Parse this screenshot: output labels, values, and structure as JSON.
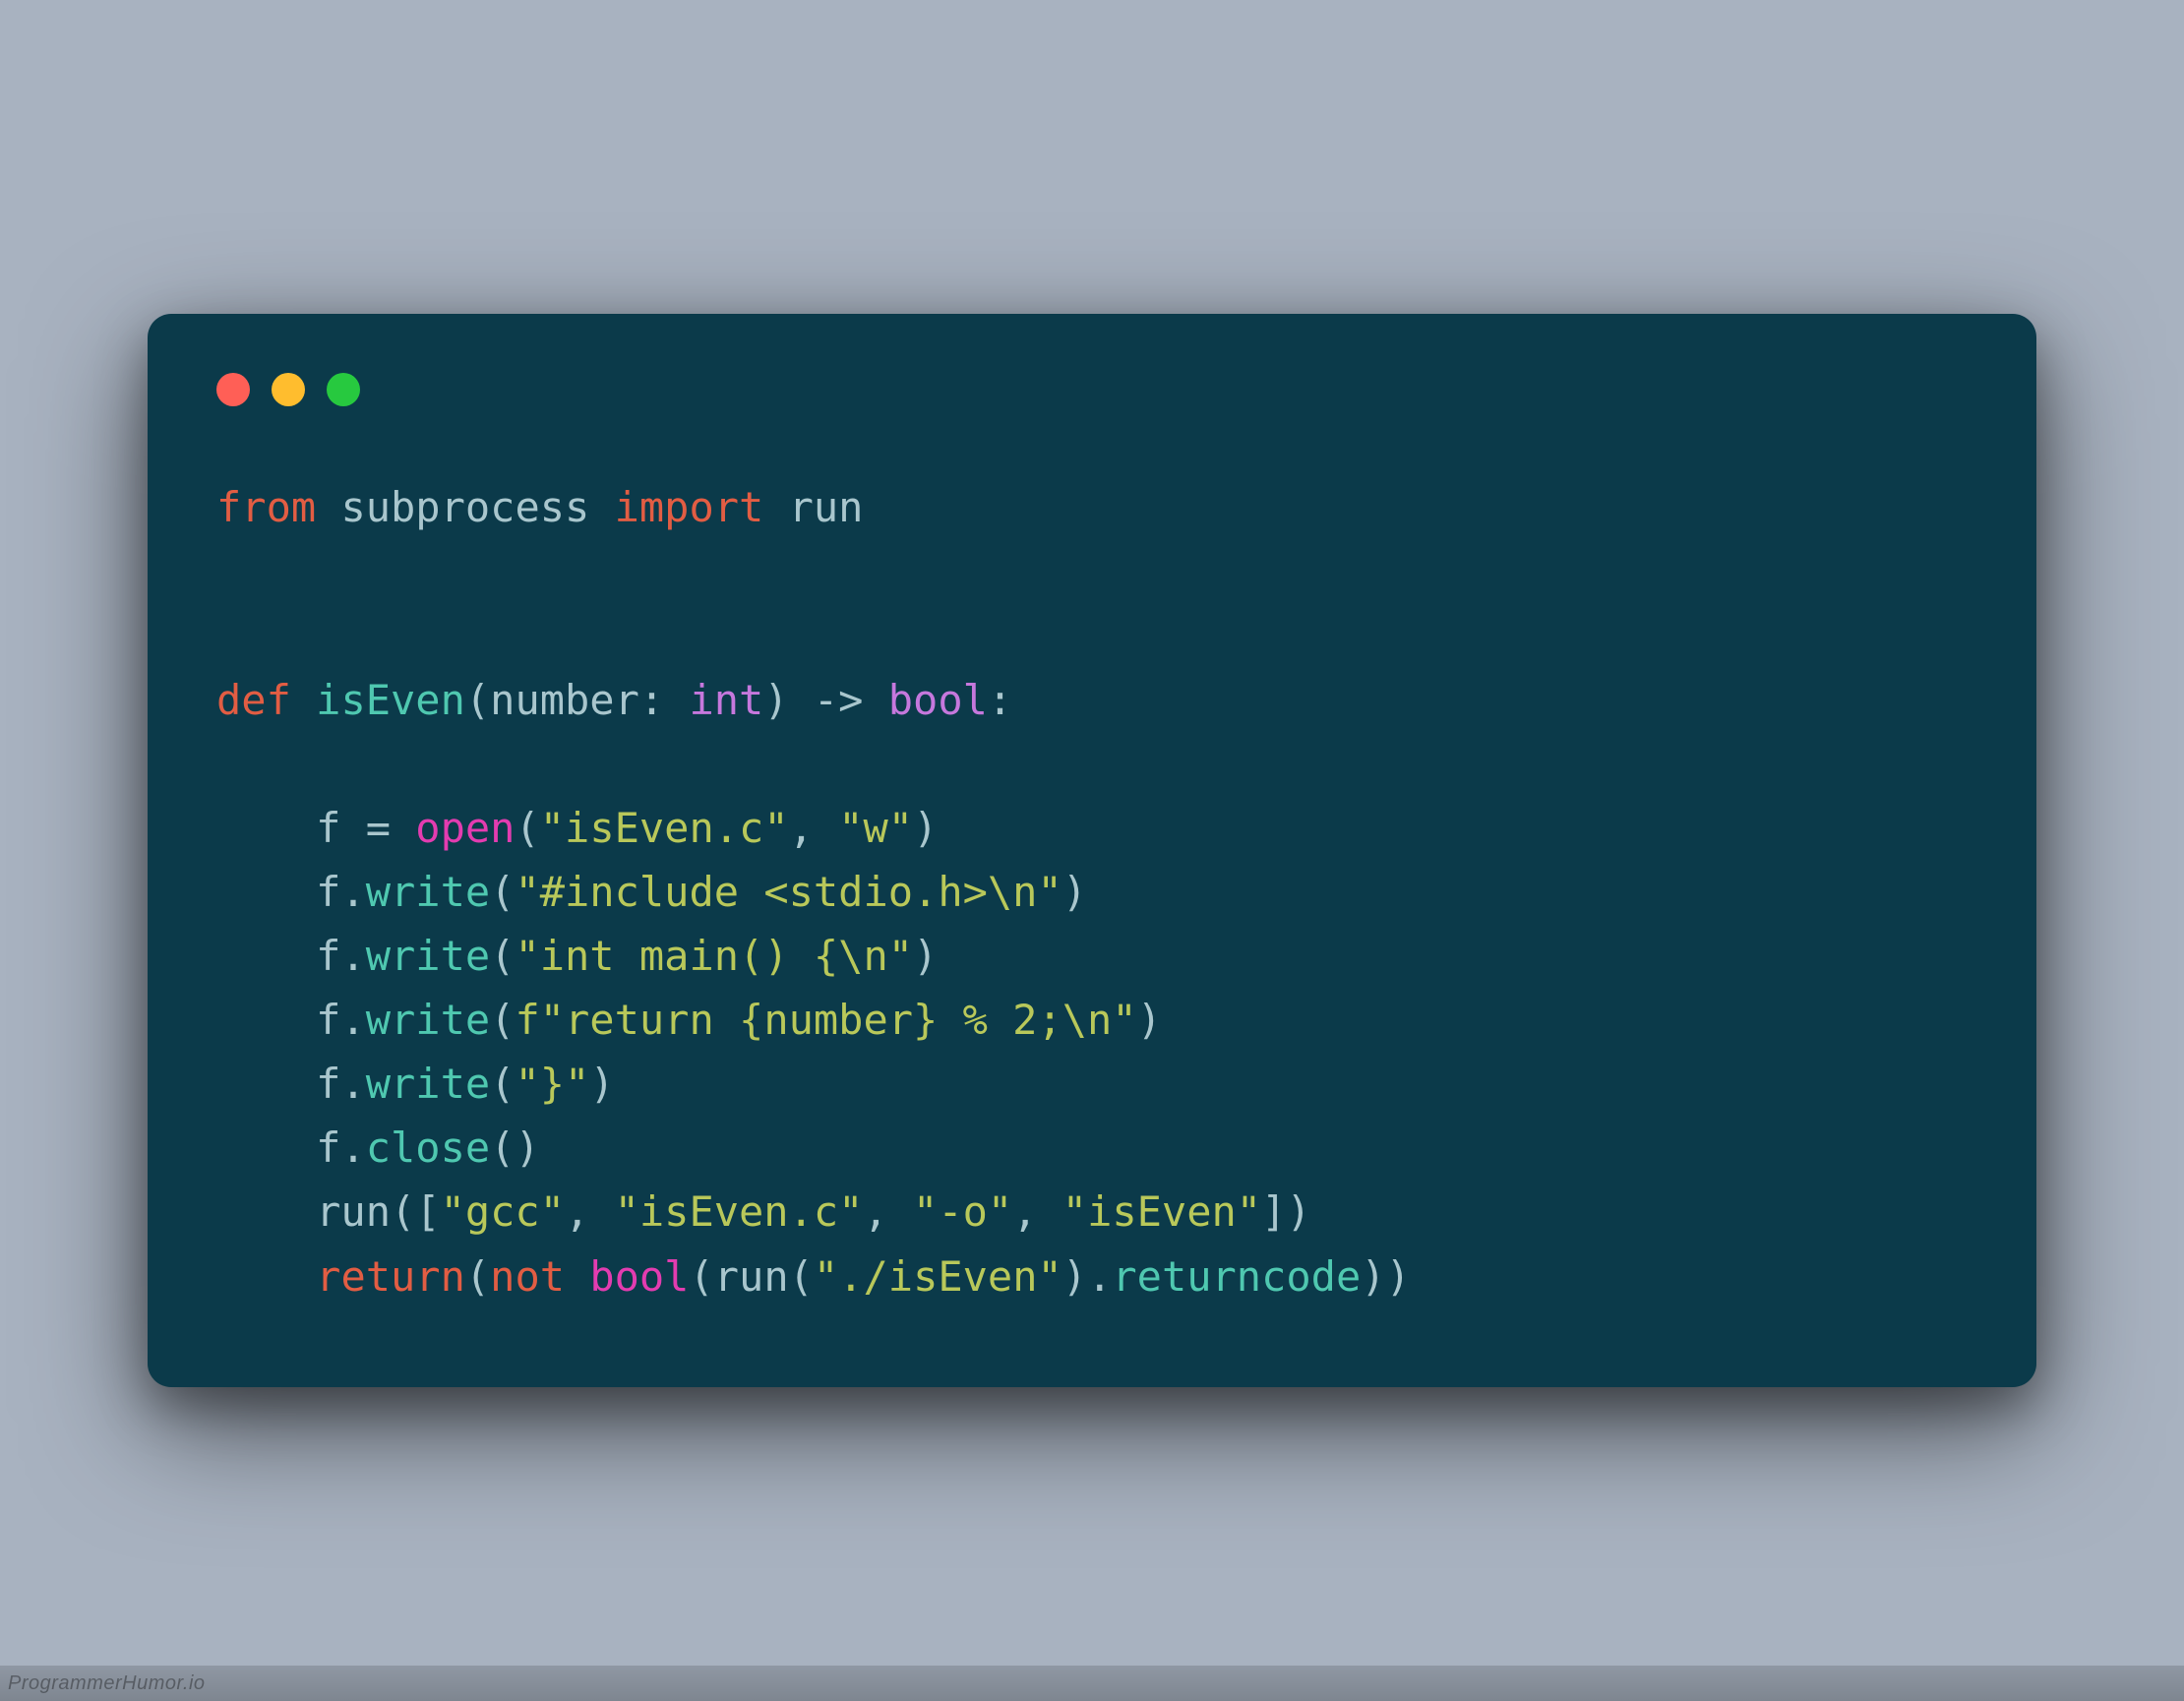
{
  "window": {
    "dots": [
      "red",
      "yellow",
      "green"
    ]
  },
  "code": {
    "tokens": [
      [
        {
          "t": "from",
          "c": "kw"
        },
        {
          "t": " subprocess ",
          "c": "plain"
        },
        {
          "t": "import",
          "c": "kw"
        },
        {
          "t": " run",
          "c": "plain"
        }
      ],
      [],
      [],
      [
        {
          "t": "def",
          "c": "kw"
        },
        {
          "t": " ",
          "c": "plain"
        },
        {
          "t": "isEven",
          "c": "fn"
        },
        {
          "t": "(number: ",
          "c": "plain"
        },
        {
          "t": "int",
          "c": "type"
        },
        {
          "t": ") -> ",
          "c": "plain"
        },
        {
          "t": "bool",
          "c": "type"
        },
        {
          "t": ":",
          "c": "plain"
        }
      ],
      [],
      [
        {
          "t": "    f = ",
          "c": "plain"
        },
        {
          "t": "open",
          "c": "builtin"
        },
        {
          "t": "(",
          "c": "plain"
        },
        {
          "t": "\"isEven.c\"",
          "c": "str"
        },
        {
          "t": ", ",
          "c": "plain"
        },
        {
          "t": "\"w\"",
          "c": "str"
        },
        {
          "t": ")",
          "c": "plain"
        }
      ],
      [
        {
          "t": "    f.",
          "c": "plain"
        },
        {
          "t": "write",
          "c": "fn"
        },
        {
          "t": "(",
          "c": "plain"
        },
        {
          "t": "\"#include <stdio.h>\\n\"",
          "c": "str"
        },
        {
          "t": ")",
          "c": "plain"
        }
      ],
      [
        {
          "t": "    f.",
          "c": "plain"
        },
        {
          "t": "write",
          "c": "fn"
        },
        {
          "t": "(",
          "c": "plain"
        },
        {
          "t": "\"int main() {\\n\"",
          "c": "str"
        },
        {
          "t": ")",
          "c": "plain"
        }
      ],
      [
        {
          "t": "    f.",
          "c": "plain"
        },
        {
          "t": "write",
          "c": "fn"
        },
        {
          "t": "(",
          "c": "plain"
        },
        {
          "t": "f\"return {number} % 2;\\n\"",
          "c": "str"
        },
        {
          "t": ")",
          "c": "plain"
        }
      ],
      [
        {
          "t": "    f.",
          "c": "plain"
        },
        {
          "t": "write",
          "c": "fn"
        },
        {
          "t": "(",
          "c": "plain"
        },
        {
          "t": "\"}\"",
          "c": "str"
        },
        {
          "t": ")",
          "c": "plain"
        }
      ],
      [
        {
          "t": "    f.",
          "c": "plain"
        },
        {
          "t": "close",
          "c": "fn"
        },
        {
          "t": "()",
          "c": "plain"
        }
      ],
      [
        {
          "t": "    run([",
          "c": "plain"
        },
        {
          "t": "\"gcc\"",
          "c": "str"
        },
        {
          "t": ", ",
          "c": "plain"
        },
        {
          "t": "\"isEven.c\"",
          "c": "str"
        },
        {
          "t": ", ",
          "c": "plain"
        },
        {
          "t": "\"-o\"",
          "c": "str"
        },
        {
          "t": ", ",
          "c": "plain"
        },
        {
          "t": "\"isEven\"",
          "c": "str"
        },
        {
          "t": "])",
          "c": "plain"
        }
      ],
      [
        {
          "t": "    ",
          "c": "plain"
        },
        {
          "t": "return",
          "c": "kw"
        },
        {
          "t": "(",
          "c": "plain"
        },
        {
          "t": "not",
          "c": "kw"
        },
        {
          "t": " ",
          "c": "plain"
        },
        {
          "t": "bool",
          "c": "builtin"
        },
        {
          "t": "(run(",
          "c": "plain"
        },
        {
          "t": "\"./isEven\"",
          "c": "str"
        },
        {
          "t": ").",
          "c": "plain"
        },
        {
          "t": "returncode",
          "c": "fn"
        },
        {
          "t": "))",
          "c": "plain"
        }
      ]
    ]
  },
  "watermark": "ProgrammerHumor.io"
}
